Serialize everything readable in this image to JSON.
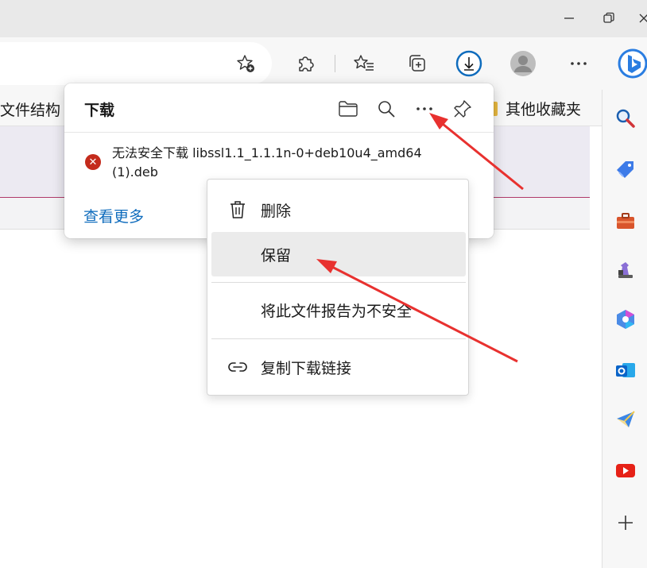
{
  "titlebar": {
    "buttons": [
      "minimize",
      "restore",
      "close"
    ]
  },
  "toolbar": {
    "icons": [
      "add-favorite-icon",
      "extensions-icon",
      "favorites-icon",
      "collections-icon",
      "downloads-icon",
      "profile-avatar",
      "more-icon",
      "bing-icon"
    ]
  },
  "favorites_bar": {
    "left_text": "文件结构",
    "right_folder": "其他收藏夹"
  },
  "downloads": {
    "title": "下载",
    "header_icons": [
      "open-folder-icon",
      "search-icon",
      "more-options-icon",
      "pin-icon"
    ],
    "item": {
      "status": "error",
      "text": "无法安全下载 libssl1.1_1.1.1n-0+deb10u4_amd64 (1).deb"
    },
    "see_more": "查看更多"
  },
  "context_menu": {
    "items": [
      {
        "label": "删除",
        "icon": "trash-icon"
      },
      {
        "label": "保留",
        "icon": ""
      },
      {
        "label": "将此文件报告为不安全",
        "icon": ""
      },
      {
        "label": "复制下载链接",
        "icon": "link-icon"
      }
    ]
  },
  "sidebar": {
    "icons": [
      "search-icon",
      "tag-icon",
      "toolbox-icon",
      "chess-icon",
      "office-icon",
      "outlook-icon",
      "send-icon",
      "youtube-icon",
      "add-icon"
    ]
  },
  "colors": {
    "accent": "#0f6cbd",
    "error": "#c42b1c",
    "annotation": "#e8312f"
  }
}
